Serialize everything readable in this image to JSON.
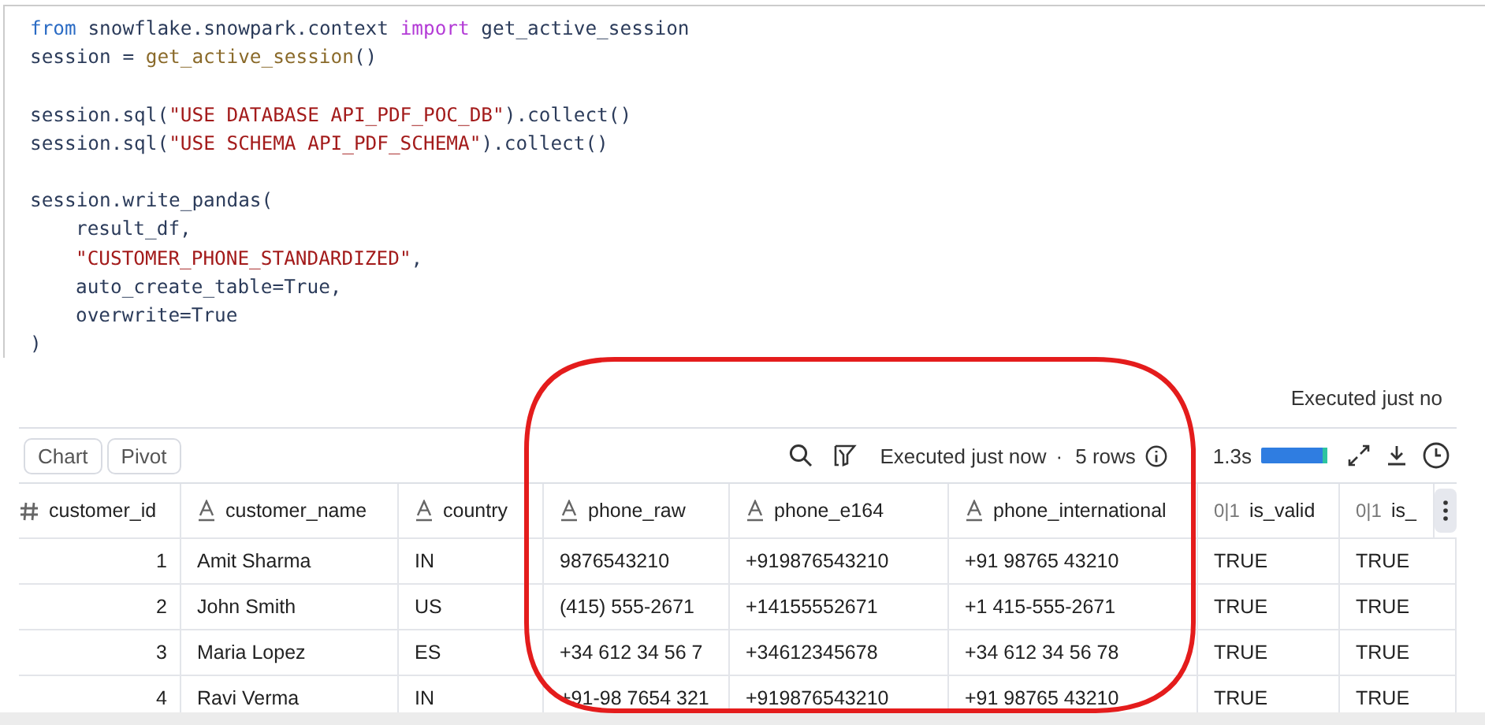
{
  "code": {
    "lines": [
      {
        "parts": [
          {
            "text": "from",
            "kind": "keyword"
          },
          {
            "text": " snowflake.snowpark.context ",
            "kind": "plain"
          },
          {
            "text": "import",
            "kind": "import"
          },
          {
            "text": " get_active_session",
            "kind": "plain"
          }
        ]
      },
      {
        "parts": [
          {
            "text": "session = ",
            "kind": "plain"
          },
          {
            "text": "get_active_session",
            "kind": "function"
          },
          {
            "text": "()",
            "kind": "plain"
          }
        ]
      },
      {
        "blank_before": true,
        "parts": [
          {
            "text": "session.sql(",
            "kind": "plain"
          },
          {
            "text": "\"USE DATABASE API_PDF_POC_DB\"",
            "kind": "string"
          },
          {
            "text": ").collect()",
            "kind": "plain"
          }
        ]
      },
      {
        "parts": [
          {
            "text": "session.sql(",
            "kind": "plain"
          },
          {
            "text": "\"USE SCHEMA API_PDF_SCHEMA\"",
            "kind": "string"
          },
          {
            "text": ").collect()",
            "kind": "plain"
          }
        ]
      },
      {
        "blank_before": true,
        "parts": [
          {
            "text": "session.write_pandas(",
            "kind": "plain"
          }
        ]
      },
      {
        "indented": true,
        "parts": [
          {
            "text": "result_df,",
            "kind": "plain"
          }
        ]
      },
      {
        "indented": true,
        "parts": [
          {
            "text": "\"CUSTOMER_PHONE_STANDARDIZED\"",
            "kind": "string"
          },
          {
            "text": ",",
            "kind": "plain"
          }
        ]
      },
      {
        "indented": true,
        "parts": [
          {
            "text": "auto_create_table=True,",
            "kind": "plain"
          }
        ]
      },
      {
        "indented": true,
        "parts": [
          {
            "text": "overwrite=True",
            "kind": "plain"
          }
        ]
      },
      {
        "parts": [
          {
            "text": ")",
            "kind": "plain"
          }
        ]
      }
    ]
  },
  "status_top": "Executed just no",
  "toolbar": {
    "buttons": [
      "Chart",
      "Pivot"
    ],
    "status": "Executed just now",
    "separator": "·",
    "rows": "5 rows",
    "duration": "1.3s"
  },
  "table": {
    "columns": [
      {
        "name": "customer_id",
        "kind": "number"
      },
      {
        "name": "customer_name",
        "kind": "text"
      },
      {
        "name": "country",
        "kind": "text"
      },
      {
        "name": "phone_raw",
        "kind": "text"
      },
      {
        "name": "phone_e164",
        "kind": "text"
      },
      {
        "name": "phone_international",
        "kind": "text"
      },
      {
        "name": "is_valid",
        "kind": "boolean",
        "icon_text": "0|1"
      },
      {
        "name": "is_",
        "kind": "boolean",
        "icon_text": "0|1"
      }
    ],
    "rows": [
      [
        "1",
        "Amit Sharma",
        "IN",
        "9876543210",
        "+919876543210",
        "+91 98765 43210",
        "TRUE",
        "TRUE"
      ],
      [
        "2",
        "John Smith",
        "US",
        "(415) 555-2671",
        "+14155552671",
        "+1 415-555-2671",
        "TRUE",
        "TRUE"
      ],
      [
        "3",
        "Maria Lopez",
        "ES",
        "+34 612 34 56 7",
        "+34612345678",
        "+34 612 34 56 78",
        "TRUE",
        "TRUE"
      ],
      [
        "4",
        "Ravi Verma",
        "IN",
        "+91-98 7654 321",
        "+919876543210",
        "+91 98765 43210",
        "TRUE",
        "TRUE"
      ]
    ]
  }
}
